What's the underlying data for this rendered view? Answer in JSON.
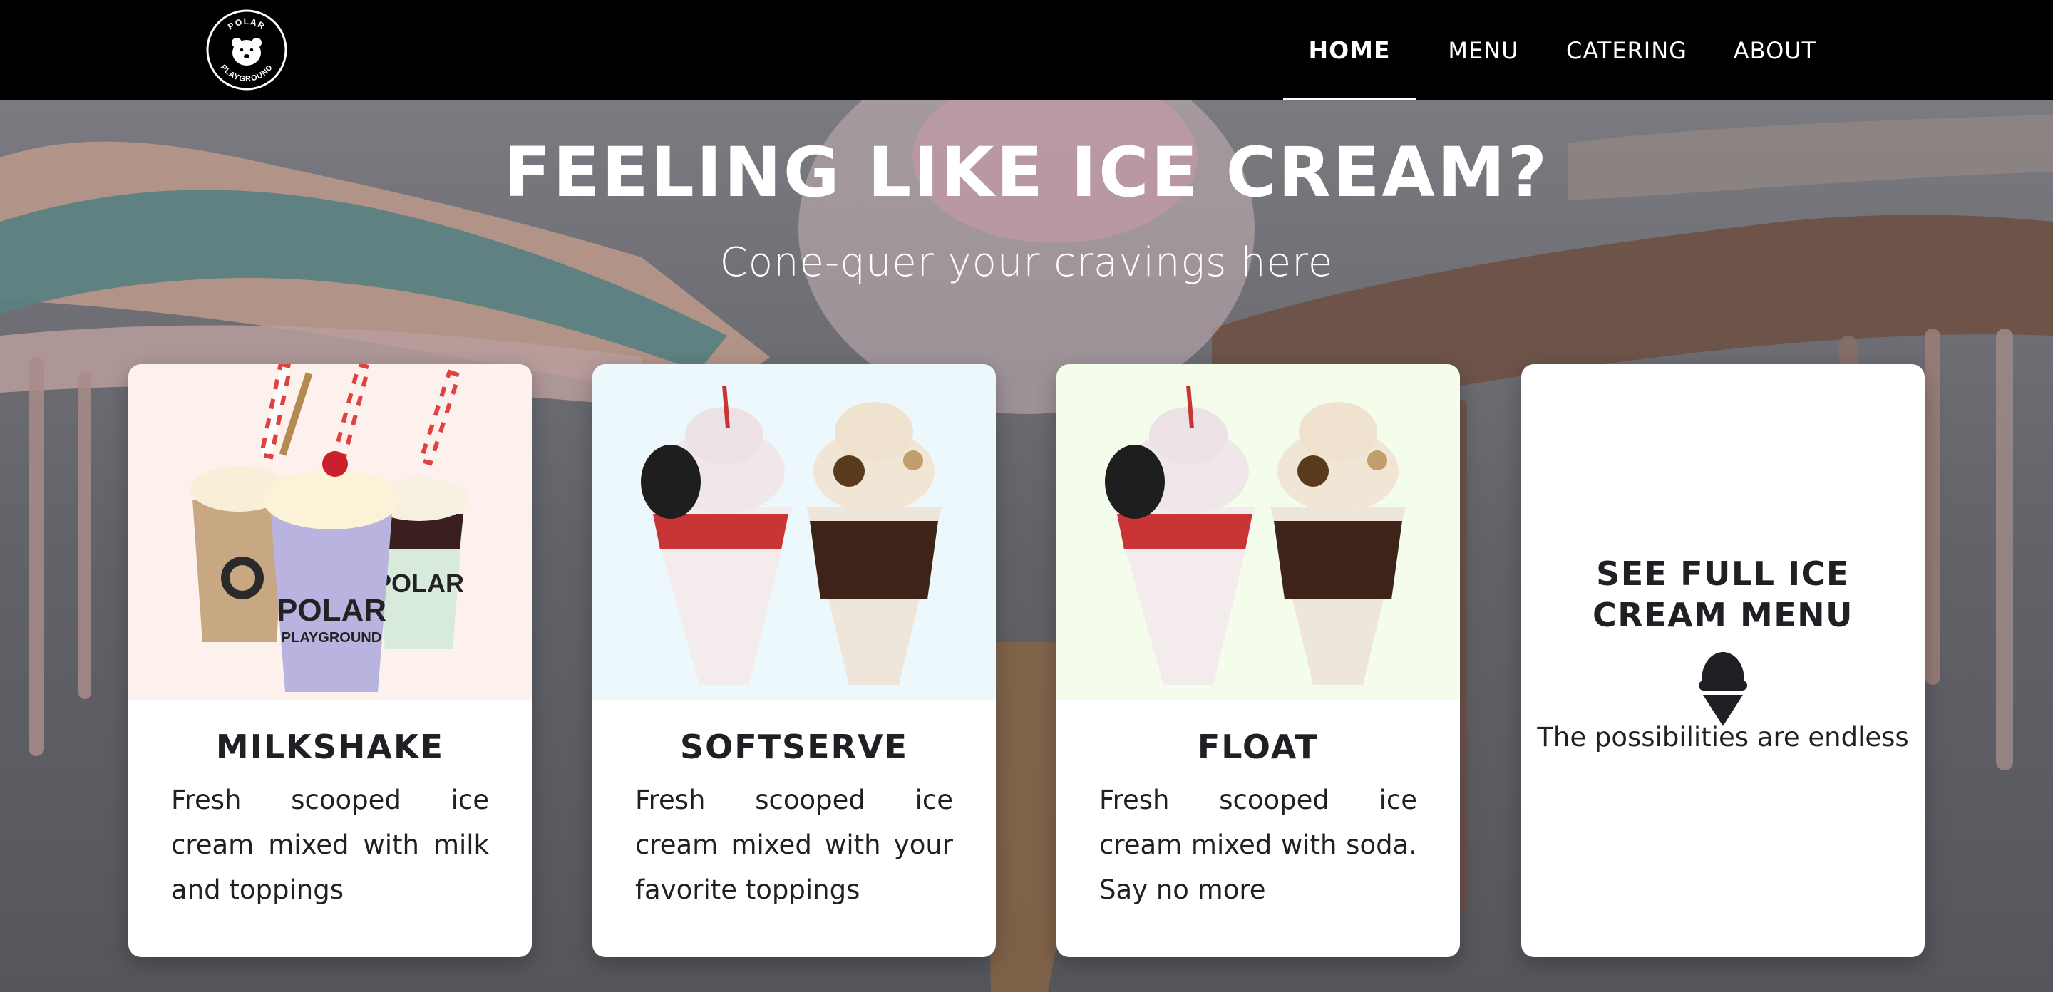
{
  "brand": {
    "logo_top_text": "POLAR",
    "logo_bottom_text": "PLAYGROUND",
    "logo_icon": "polar-bear-icon"
  },
  "nav": {
    "items": [
      {
        "label": "HOME",
        "active": true
      },
      {
        "label": "MENU",
        "active": false
      },
      {
        "label": "CATERING",
        "active": false
      },
      {
        "label": "ABOUT",
        "active": false
      }
    ]
  },
  "hero": {
    "title": "FEELING LIKE ICE CREAM?",
    "subtitle": "Cone-quer your cravings here"
  },
  "cards": [
    {
      "title": "MILKSHAKE",
      "description": "Fresh scooped ice cream mixed with milk and toppings",
      "image": "milkshakes-image",
      "bg_color": "#fdf1ee"
    },
    {
      "title": "SOFTSERVE",
      "description": "Fresh scooped ice cream mixed with your favorite toppings",
      "image": "softserve-sundaes-image",
      "bg_color": "#edf8fc"
    },
    {
      "title": "FLOAT",
      "description": "Fresh scooped ice cream mixed with soda. Say no more",
      "image": "float-sundaes-image",
      "bg_color": "#f4fdec"
    }
  ],
  "menu_cta": {
    "title_line1": "SEE FULL ICE",
    "title_line2": "CREAM MENU",
    "icon": "ice-cream-cone-icon",
    "tagline": "The possibilities are endless"
  },
  "cup_label": "POLAR PLAYGROUND",
  "colors": {
    "nav_bg": "#000000",
    "text_dark": "#1f1f24",
    "hero_text": "#ffffff"
  }
}
